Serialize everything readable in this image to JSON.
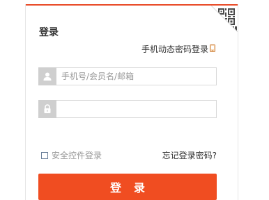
{
  "login": {
    "title": "登录",
    "mobile_login_link": "手机动态密码登录",
    "username_placeholder": "手机号/会员名/邮箱",
    "password_value": "",
    "safe_control_label": "安全控件登录",
    "forgot_password": "忘记登录密码?",
    "submit_label": "登录"
  },
  "colors": {
    "accent": "#f04d21",
    "top_bar": "#e94a27",
    "icon_bg": "#cfcfcf"
  },
  "icons": [
    "qr-code-icon",
    "phone-icon",
    "user-icon",
    "lock-icon",
    "checkbox"
  ]
}
